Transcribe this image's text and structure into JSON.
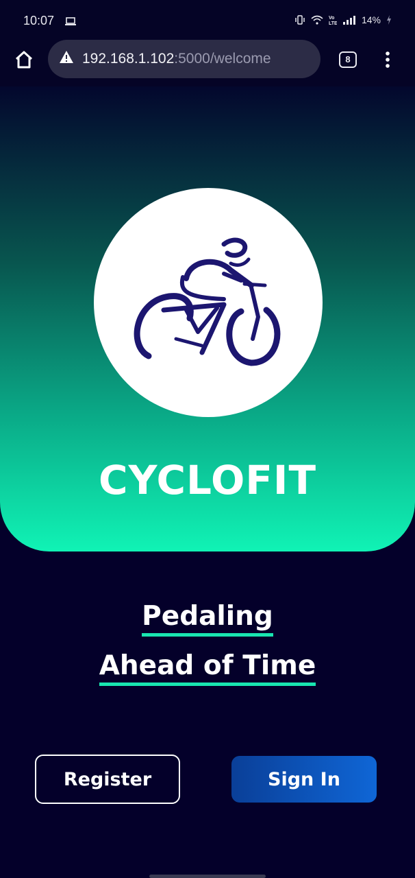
{
  "status_bar": {
    "time": "10:07",
    "battery": "14%",
    "icons": [
      "laptop-icon",
      "vibrate-icon",
      "wifi-icon",
      "volte-icon",
      "signal-icon",
      "charging-icon"
    ]
  },
  "browser": {
    "url_host": "192.168.1.102",
    "url_path": ":5000/welcome",
    "tab_count": "8",
    "icons": [
      "home-icon",
      "warning-icon",
      "menu-icon"
    ]
  },
  "app": {
    "brand_name": "CYCLOFIT",
    "logo_icon": "cyclist-icon",
    "tagline_line1": "Pedaling",
    "tagline_line2": "Ahead of Time",
    "register_label": "Register",
    "signin_label": "Sign In"
  },
  "colors": {
    "background": "#04002a",
    "gradient_top": "#03072d",
    "gradient_bottom": "#10f3b5",
    "accent_underline": "#19e6b0",
    "signin_button": "#0f66d6",
    "logo_ink": "#1c1670"
  }
}
